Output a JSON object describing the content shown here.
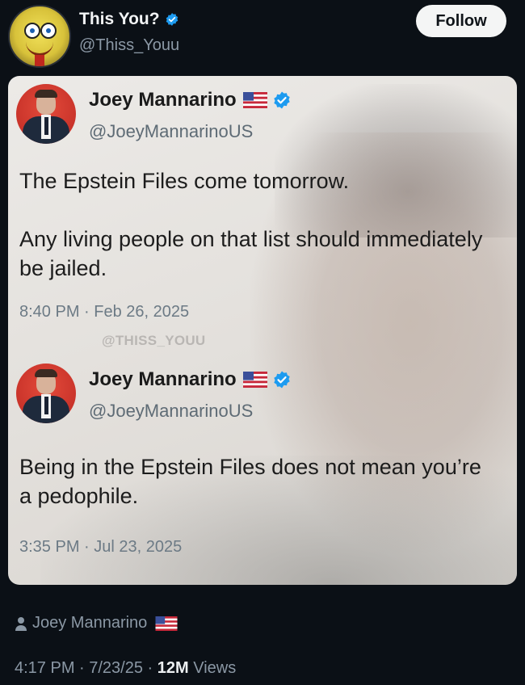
{
  "header": {
    "display_name": "This You?",
    "handle": "@Thiss_Youu",
    "follow_label": "Follow",
    "verified_icon": "verified-badge-icon",
    "avatar_icon": "spongebob-avatar"
  },
  "media": {
    "tweets": [
      {
        "name": "Joey Mannarino",
        "handle": "@JoeyMannarinoUS",
        "text": "The Epstein Files come tomorrow.\n\nAny living people on that list should immediately be jailed.",
        "timestamp": "8:40 PM · Feb 26, 2025"
      },
      {
        "name": "Joey Mannarino",
        "handle": "@JoeyMannarinoUS",
        "text": "Being in the Epstein Files does not mean you’re a pedophile.",
        "timestamp": "3:35 PM · Jul 23, 2025"
      }
    ],
    "watermark": "@THISS_YOUU"
  },
  "footer": {
    "author": "Joey Mannarino",
    "time": "4:17 PM · 7/23/25 · ",
    "views_count": "12M",
    "views_label": " Views"
  },
  "colors": {
    "background": "#0b1016",
    "verified_blue": "#1d9bf0",
    "follow_bg": "#f4f5f5",
    "muted_text": "#8b98a5"
  }
}
